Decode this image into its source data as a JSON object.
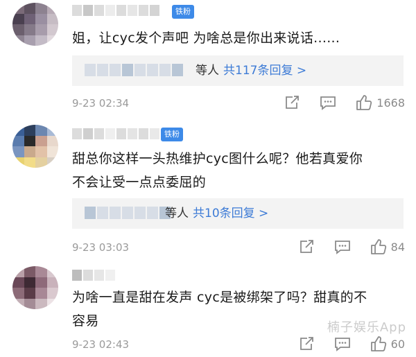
{
  "comments": [
    {
      "badge": "铁粉",
      "text": "姐，让cyc发个声吧 为啥总是你出来说话......",
      "reply": {
        "suffix": "等人",
        "link": "共117条回复 >"
      },
      "time": "9-23 02:34",
      "likes": "1668"
    },
    {
      "badge": "铁粉",
      "text_lines": [
        "甜总你这样一头热维护cyc图什么呢？他若真爱你",
        "不会让受一点点委屈的"
      ],
      "reply": {
        "suffix": "等人",
        "link": "共10条回复 >"
      },
      "time": "9-23 03:03",
      "likes": "84"
    },
    {
      "text_lines": [
        "为啥一直是甜在发声 cyc是被绑架了吗？甜真的不",
        "容易"
      ],
      "time": "9-23 02:43",
      "likes": "60"
    }
  ],
  "watermark": "楠子娱乐App",
  "icons": {
    "share": "share-icon",
    "comment": "comment-icon",
    "like": "thumbs-up-icon"
  },
  "colors": {
    "badge": "#3d8ae8",
    "link": "#3d7bd6",
    "meta": "#9a9a9a"
  }
}
